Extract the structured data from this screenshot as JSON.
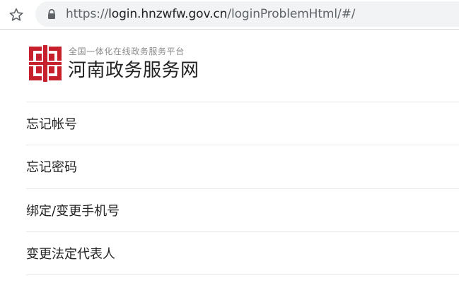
{
  "browser": {
    "url_scheme": "https://",
    "url_host": "login.hnzwfw.gov.cn",
    "url_path": "/loginProblemHtml/#/"
  },
  "brand": {
    "subtitle": "全国一体化在线政务服务平台",
    "title": "河南政务服务网",
    "logo_color": "#c7202d"
  },
  "menu": {
    "items": [
      {
        "label": "忘记帐号"
      },
      {
        "label": "忘记密码"
      },
      {
        "label": "绑定/变更手机号"
      },
      {
        "label": "变更法定代表人"
      }
    ]
  }
}
